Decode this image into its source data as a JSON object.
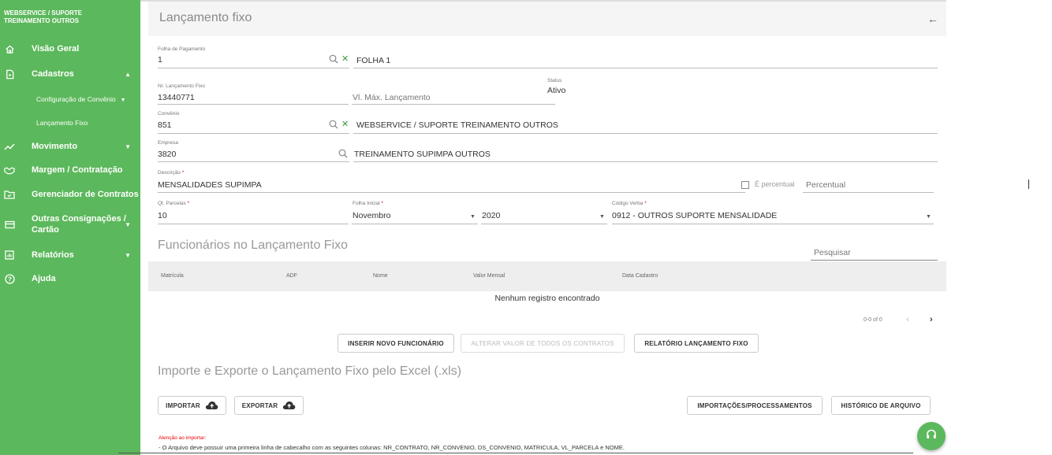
{
  "sidebar": {
    "brand_line1": "WEBSERVICE / SUPORTE",
    "brand_line2": "TREINAMENTO OUTROS",
    "items": [
      {
        "label": "Visão Geral",
        "icon": "home-icon"
      },
      {
        "label": "Cadastros",
        "icon": "document-icon"
      },
      {
        "label": "Configuração de Convênio",
        "icon": ""
      },
      {
        "label": "Lançamento Fixo",
        "icon": ""
      },
      {
        "label": "Movimento",
        "icon": "trending-icon"
      },
      {
        "label": "Margem / Contratação",
        "icon": "handshake-icon"
      },
      {
        "label": "Gerenciador de Contratos",
        "icon": "folder-icon"
      },
      {
        "label": "Outras Consignações /",
        "label2": "Cartão",
        "icon": "card-icon"
      },
      {
        "label": "Relatórios",
        "icon": "report-icon"
      },
      {
        "label": "Ajuda",
        "icon": "help-icon"
      }
    ]
  },
  "page": {
    "title": "Lançamento fixo"
  },
  "form": {
    "folha": {
      "label": "Folha de Pagamento",
      "value": "1",
      "desc": "FOLHA 1"
    },
    "nr_lancamento": {
      "label": "Nr. Lançamento Fixo",
      "value": "13440771"
    },
    "vl_max": {
      "placeholder": "Vl. Máx. Lançamento"
    },
    "status": {
      "label": "Status",
      "value": "Ativo"
    },
    "convenio": {
      "label": "Convênio",
      "value": "851",
      "desc": "WEBSERVICE / SUPORTE TREINAMENTO OUTROS"
    },
    "empresa": {
      "label": "Empresa",
      "value": "3820",
      "desc": "TREINAMENTO SUPIMPA OUTROS"
    },
    "descricao": {
      "label": "Descrição",
      "value": "MENSALIDADES SUPIMPA"
    },
    "percentual_check": {
      "label": "É percentual"
    },
    "percentual": {
      "placeholder": "Percentual"
    },
    "qt_parcelas": {
      "label": "Qt. Parcelas",
      "value": "10"
    },
    "folha_inicial": {
      "label": "Folha Inicial",
      "month": "Novembro",
      "year": "2020"
    },
    "codigo_verba": {
      "label": "Código Verba",
      "value": "0912 - OUTROS SUPORTE MENSALIDADE"
    },
    "required_mark": "*"
  },
  "funcionarios": {
    "title": "Funcionários no Lançamento Fixo",
    "search_placeholder": "Pesquisar",
    "columns": [
      "Matrícula",
      "ADF",
      "Nome",
      "Valor Mensal",
      "Data Cadastro"
    ],
    "empty": "Nenhum registro encontrado",
    "pager": "0-0 of 0",
    "prev": "‹",
    "next": "›"
  },
  "buttons": {
    "inserir": "INSERIR NOVO FUNCIONÁRIO",
    "alterar": "ALTERAR VALOR DE TODOS OS CONTRATOS",
    "relatorio": "RELATÓRIO LANÇAMENTO FIXO",
    "importar": "IMPORTAR",
    "exportar": "EXPORTAR",
    "importacoes": "IMPORTAÇÕES/PROCESSAMENTOS",
    "historico": "HISTÓRICO DE ARQUIVO"
  },
  "excel": {
    "title": "Importe e Exporte o Lançamento Fixo pelo Excel (.xls)"
  },
  "warning": {
    "title": "Atenção ao importar:",
    "text": "- O Arquivo deve possuir uma primeira linha de cabecalho com as seguintes colunas: NR_CONTRATO, NR_CONVENIO, DS_CONVENIO, MATRICULA, VL_PARCELA e NOME."
  },
  "colors": {
    "sidebar": "#5cb85c",
    "accent": "#3a9a3a",
    "required": "#dd0000"
  }
}
